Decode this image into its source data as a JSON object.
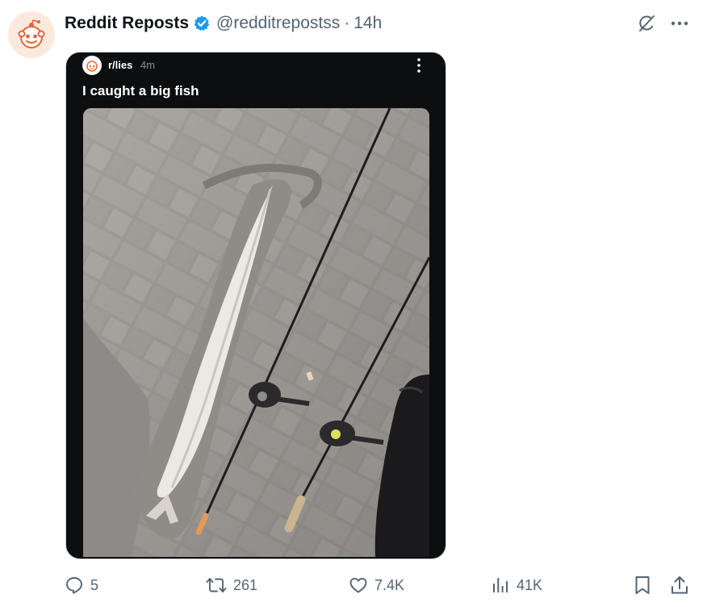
{
  "tweet": {
    "display_name": "Reddit Reposts",
    "handle": "@redditrepostss",
    "separator": "·",
    "time": "14h"
  },
  "reddit_post": {
    "subreddit": "r/lies",
    "age": "4m",
    "title": "I caught a big fish"
  },
  "actions": {
    "replies": "5",
    "reposts": "261",
    "likes": "7.4K",
    "views": "41K"
  },
  "icons": {
    "avatar": "reddit-snoo-icon",
    "verified": "verified-badge-icon",
    "grok": "grok-icon",
    "more": "more-horizontal-icon",
    "reply": "reply-icon",
    "repost": "repost-icon",
    "like": "heart-icon",
    "views": "analytics-icon",
    "bookmark": "bookmark-icon",
    "share": "share-icon"
  },
  "colors": {
    "verified_blue": "#1d9bf0",
    "muted_text": "#536471",
    "post_background": "#0d0e10",
    "snoo_orange": "#e8633a"
  }
}
